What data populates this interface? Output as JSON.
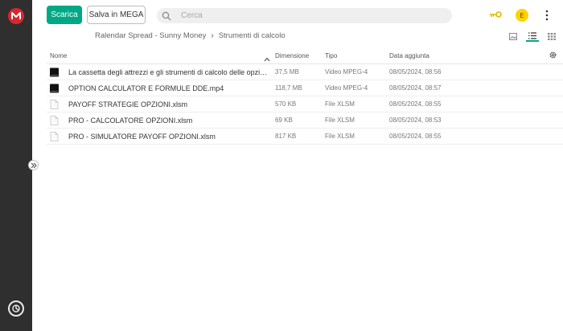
{
  "toolbar": {
    "download_label": "Scarica",
    "save_label": "Salva in MEGA",
    "search_placeholder": "Cerca",
    "avatar_initial": "E"
  },
  "breadcrumb": {
    "items": [
      "Ralendar Spread - Sunny Money",
      "Strumenti di calcolo"
    ],
    "separator": "›"
  },
  "table": {
    "headers": {
      "name": "Nome",
      "size": "Dimensione",
      "type": "Tipo",
      "date": "Data aggiunta"
    },
    "rows": [
      {
        "name": "La cassetta degli attrezzi e gli strumenti di calcolo delle opzioni....",
        "size": "37,5 MB",
        "type": "Video MPEG-4",
        "date": "08/05/2024, 08:56",
        "icon": "video-file-icon"
      },
      {
        "name": "OPTION CALCULATOR E FORMULE DDE.mp4",
        "size": "118,7 MB",
        "type": "Video MPEG-4",
        "date": "08/05/2024, 08:57",
        "icon": "video-file-icon"
      },
      {
        "name": "PAYOFF STRATEGIE OPZIONI.xlsm",
        "size": "570 KB",
        "type": "File XLSM",
        "date": "08/05/2024, 08:55",
        "icon": "generic-file-icon"
      },
      {
        "name": "PRO - CALCOLATORE OPZIONI.xlsm",
        "size": "69 KB",
        "type": "File XLSM",
        "date": "08/05/2024, 08:53",
        "icon": "generic-file-icon"
      },
      {
        "name": "PRO - SIMULATORE PAYOFF OPZIONI.xlsm",
        "size": "817 KB",
        "type": "File XLSM",
        "date": "08/05/2024, 08:55",
        "icon": "generic-file-icon"
      }
    ]
  },
  "colors": {
    "accent": "#00a886",
    "brand": "#d9272e",
    "rail": "#2f2f2f",
    "avatar": "#ffd300"
  }
}
